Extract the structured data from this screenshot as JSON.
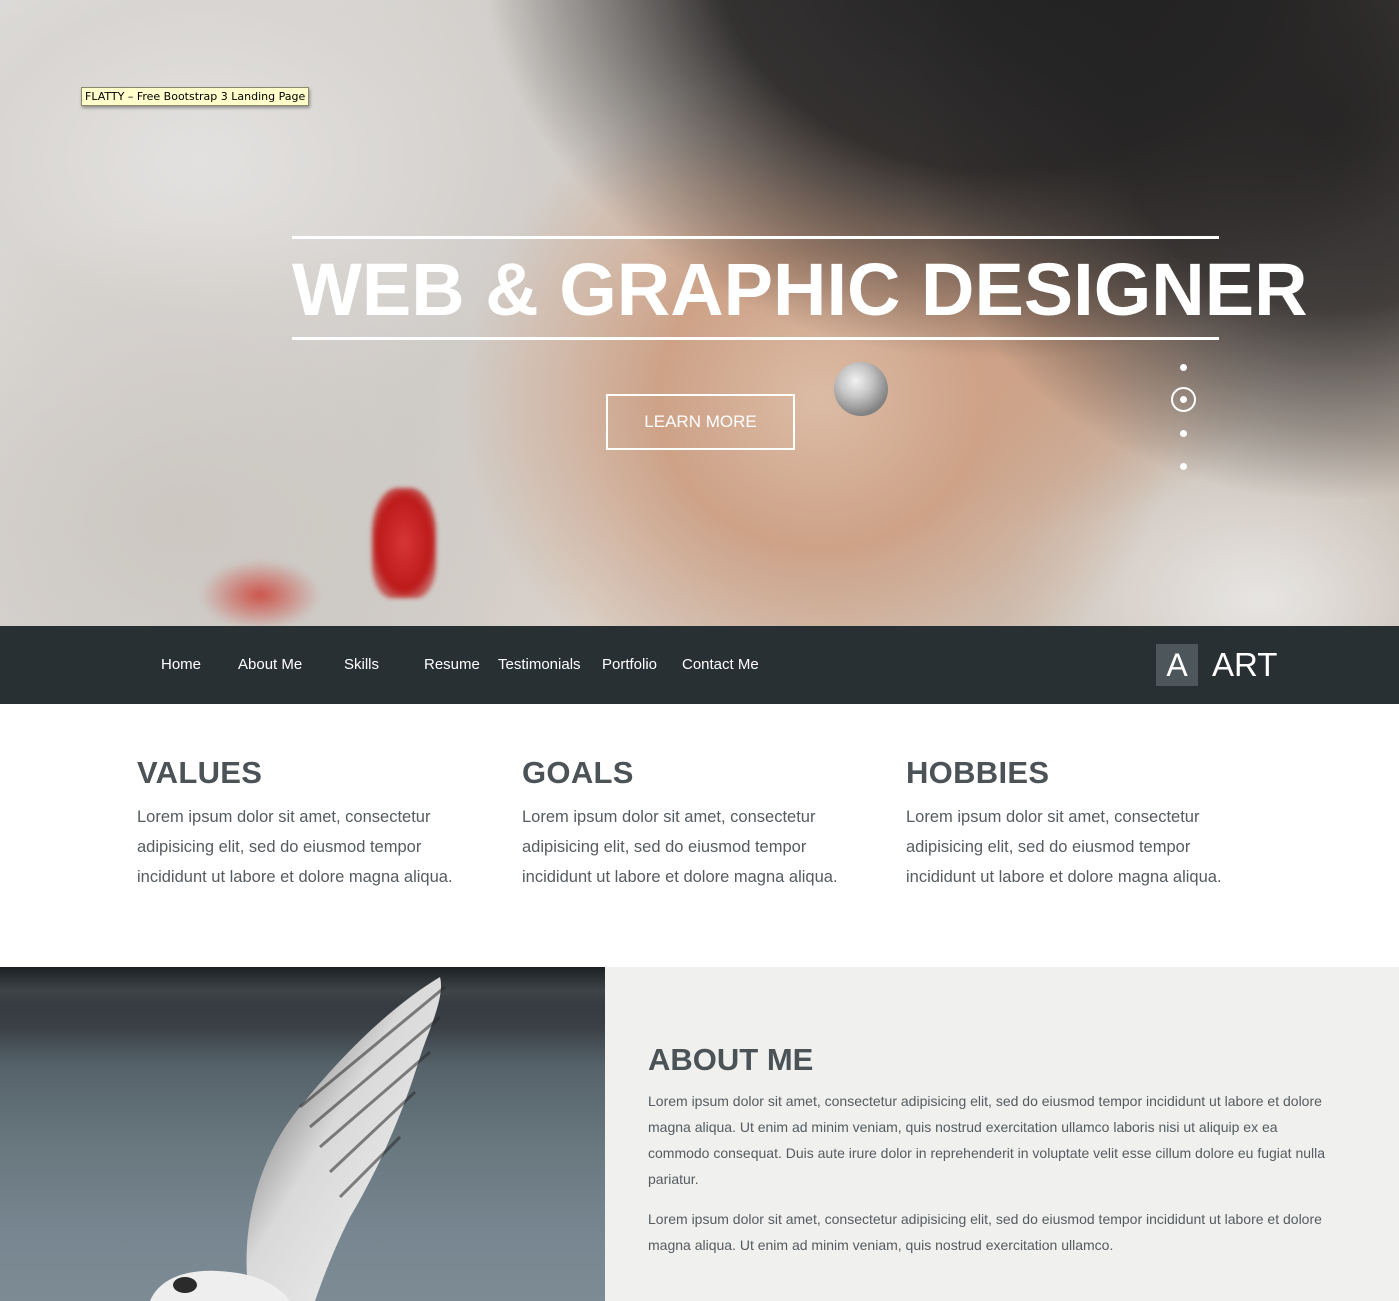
{
  "tooltip": "FLATTY – Free Bootstrap 3 Landing Page",
  "hero": {
    "title": "WEB & GRAPHIC DESIGNER",
    "button": "LEARN MORE",
    "slides_count": 4,
    "active_slide": 2
  },
  "nav": {
    "items": [
      "Home",
      "About Me",
      "Skills",
      "Resume",
      "Testimonials",
      "Portfolio",
      "Contact Me"
    ],
    "brand_letter": "A",
    "brand_name": "ART"
  },
  "features": [
    {
      "title": "VALUES",
      "text": "Lorem ipsum dolor sit amet, consectetur adipisicing elit, sed do eiusmod tempor incididunt ut labore et dolore magna aliqua."
    },
    {
      "title": "GOALS",
      "text": "Lorem ipsum dolor sit amet, consectetur adipisicing elit, sed do eiusmod tempor incididunt ut labore et dolore magna aliqua."
    },
    {
      "title": "HOBBIES",
      "text": "Lorem ipsum dolor sit amet, consectetur adipisicing elit, sed do eiusmod tempor incididunt ut labore et dolore magna aliqua."
    }
  ],
  "about": {
    "title": "ABOUT ME",
    "paragraph1": "Lorem ipsum dolor sit amet, consectetur adipisicing elit, sed do eiusmod tempor incididunt ut labore et dolore magna aliqua. Ut enim ad minim veniam, quis nostrud exercitation ullamco laboris nisi ut aliquip ex ea commodo consequat. Duis aute irure dolor in reprehenderit in voluptate velit esse cillum dolore eu fugiat nulla pariatur.",
    "paragraph2": "Lorem ipsum dolor sit amet, consectetur adipisicing elit, sed do eiusmod tempor incididunt ut labore et dolore magna aliqua. Ut enim ad minim veniam, quis nostrud exercitation ullamco."
  },
  "colors": {
    "navbar": "#283034",
    "brand_box": "#4d565b",
    "heading": "#4c5357",
    "body_text": "#555b5f",
    "about_bg": "#f0f0ef"
  }
}
